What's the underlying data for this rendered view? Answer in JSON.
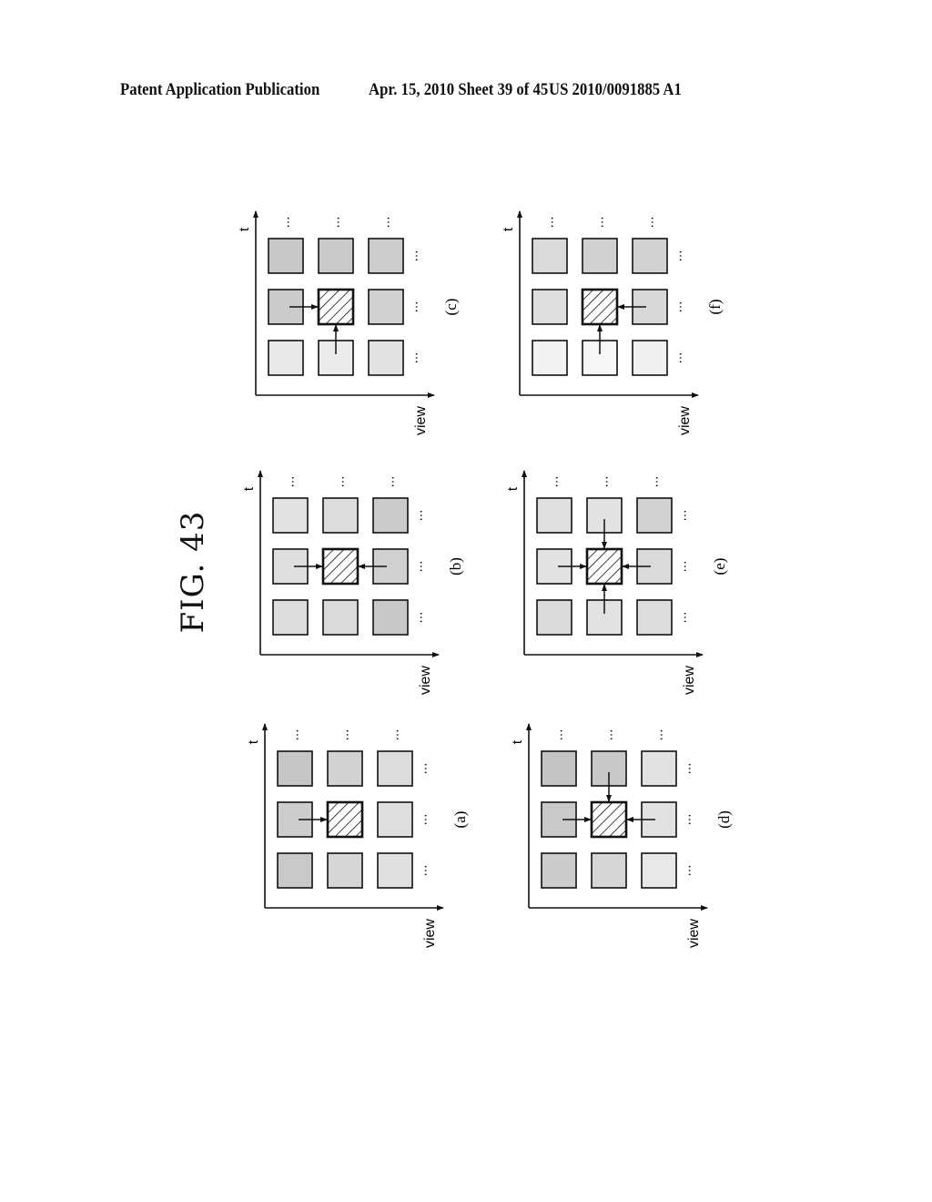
{
  "header": {
    "publication_type": "Patent Application Publication",
    "date_sheet": "Apr. 15, 2010  Sheet 39 of 45",
    "pub_number": "US 2010/0091885 A1"
  },
  "figure": {
    "title": "FIG. 43",
    "axis_labels": {
      "horizontal_axis": "view",
      "vertical_axis": "t"
    },
    "continuation_mark": "…",
    "grid": {
      "rows": 3,
      "cols": 3,
      "current_cell": "center",
      "current_block_pattern": "diagonal-hatch"
    },
    "panels": [
      {
        "id": "a",
        "label": "(a)",
        "references": [
          "left"
        ],
        "shade": [
          "#c9c9c9",
          "#d6d6d6",
          "#e0e0e0",
          "#cdcdcd",
          "#ffffff",
          "#dedede",
          "#c6c6c6",
          "#d2d2d2",
          "#dcdcdc"
        ]
      },
      {
        "id": "b",
        "label": "(b)",
        "references": [
          "left",
          "right"
        ],
        "shade": [
          "#dcdcdc",
          "#dadada",
          "#c8c8c8",
          "#dedede",
          "#ffffff",
          "#d0d0d0",
          "#e2e2e2",
          "#dcdcdc",
          "#cbcbcb"
        ]
      },
      {
        "id": "c",
        "label": "(c)",
        "references": [
          "left",
          "below"
        ],
        "shade": [
          "#e8e8e8",
          "#ebebeb",
          "#e2e2e2",
          "#cccccc",
          "#ffffff",
          "#d0d0d0",
          "#c8c8c8",
          "#cacaca",
          "#cdcdcd"
        ]
      },
      {
        "id": "d",
        "label": "(d)",
        "references": [
          "left",
          "right",
          "above"
        ],
        "shade": [
          "#cccccc",
          "#d6d6d6",
          "#e8e8e8",
          "#c9c9c9",
          "#ffffff",
          "#e2e2e2",
          "#c4c4c4",
          "#c8c8c8",
          "#e2e2e2"
        ]
      },
      {
        "id": "e",
        "label": "(e)",
        "references": [
          "left",
          "right",
          "above",
          "below"
        ],
        "shade": [
          "#dadada",
          "#e2e2e2",
          "#dcdcdc",
          "#e2e2e2",
          "#ffffff",
          "#dadada",
          "#e0e0e0",
          "#e2e2e2",
          "#d2d2d2"
        ]
      },
      {
        "id": "f",
        "label": "(f)",
        "references": [
          "right",
          "below"
        ],
        "shade": [
          "#f2f2f2",
          "#f6f6f6",
          "#f0f0f0",
          "#dedede",
          "#ffffff",
          "#d8d8d8",
          "#dadada",
          "#d0d0d0",
          "#d2d2d2"
        ]
      }
    ]
  }
}
